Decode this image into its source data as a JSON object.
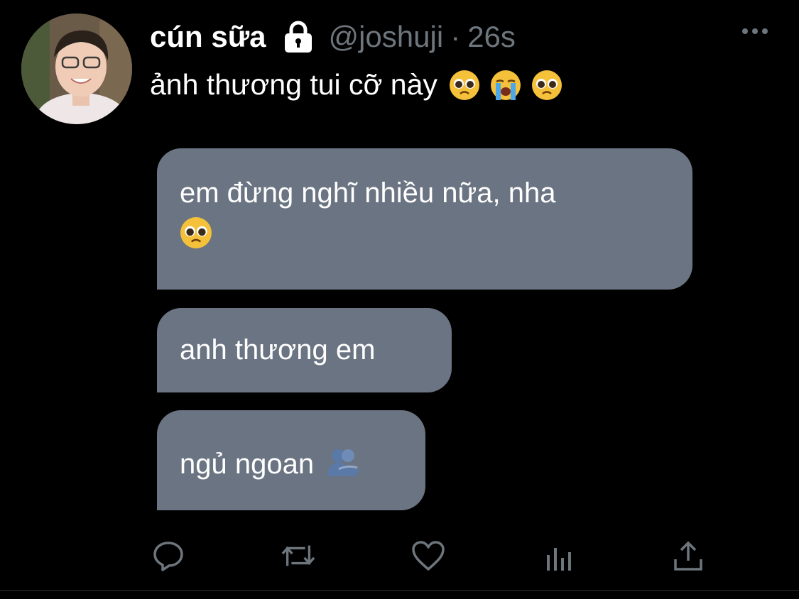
{
  "tweet": {
    "display_name": "cún sữa",
    "handle": "@joshuji",
    "separator": "·",
    "time": "26s",
    "text": "ảnh thương tui cỡ này",
    "text_emojis": [
      "pleading-face-emoji",
      "loudly-crying-face-emoji",
      "pleading-face-emoji"
    ]
  },
  "image": {
    "bubbles": [
      {
        "text": "em đừng nghĩ nhiều nữa, nha",
        "emoji": "pleading-face-emoji"
      },
      {
        "text": "anh thương em"
      },
      {
        "text": "ngủ ngoan",
        "emoji": "people-hugging-emoji"
      }
    ]
  },
  "actions": [
    "reply-icon",
    "retweet-icon",
    "like-icon",
    "analytics-icon",
    "share-icon"
  ],
  "colors": {
    "background": "#000000",
    "secondary_text": "#6e767d",
    "bubble": "#6b7482"
  }
}
